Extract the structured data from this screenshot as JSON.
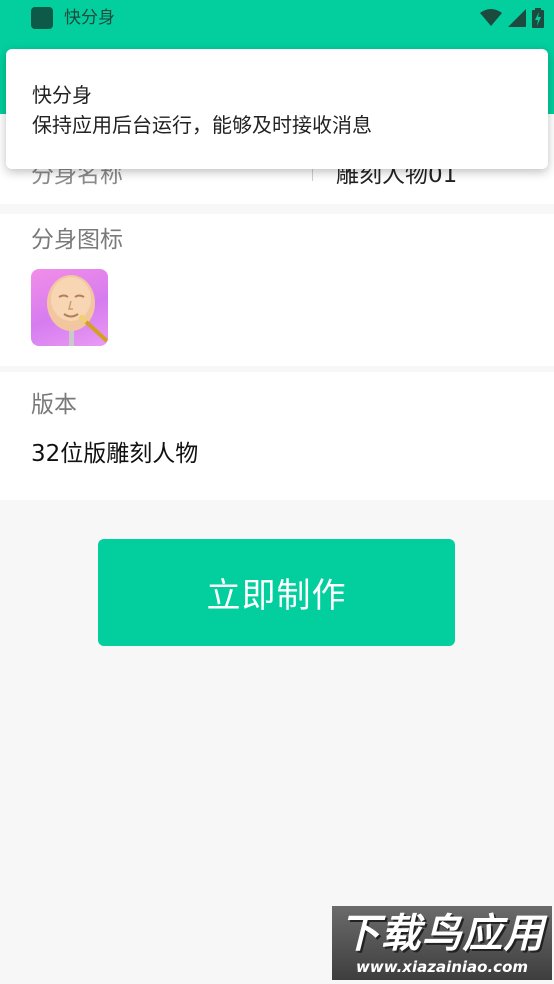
{
  "status_bar": {
    "app_title": "快分身",
    "icons": [
      "wifi-icon",
      "signal-icon",
      "battery-charging-icon"
    ]
  },
  "notification": {
    "title": "快分身",
    "text": "保持应用后台运行，能够及时接收消息"
  },
  "form": {
    "name_label": "分身名称",
    "name_value": "雕刻人物01",
    "icon_label": "分身图标",
    "version_label": "版本",
    "version_value": "32位版雕刻人物"
  },
  "actions": {
    "make_label": "立即制作"
  },
  "watermark": {
    "main": "下载鸟应用",
    "url": "www.xiazainiao.com"
  },
  "colors": {
    "accent": "#03cf9e",
    "background": "#f7f7f7"
  }
}
